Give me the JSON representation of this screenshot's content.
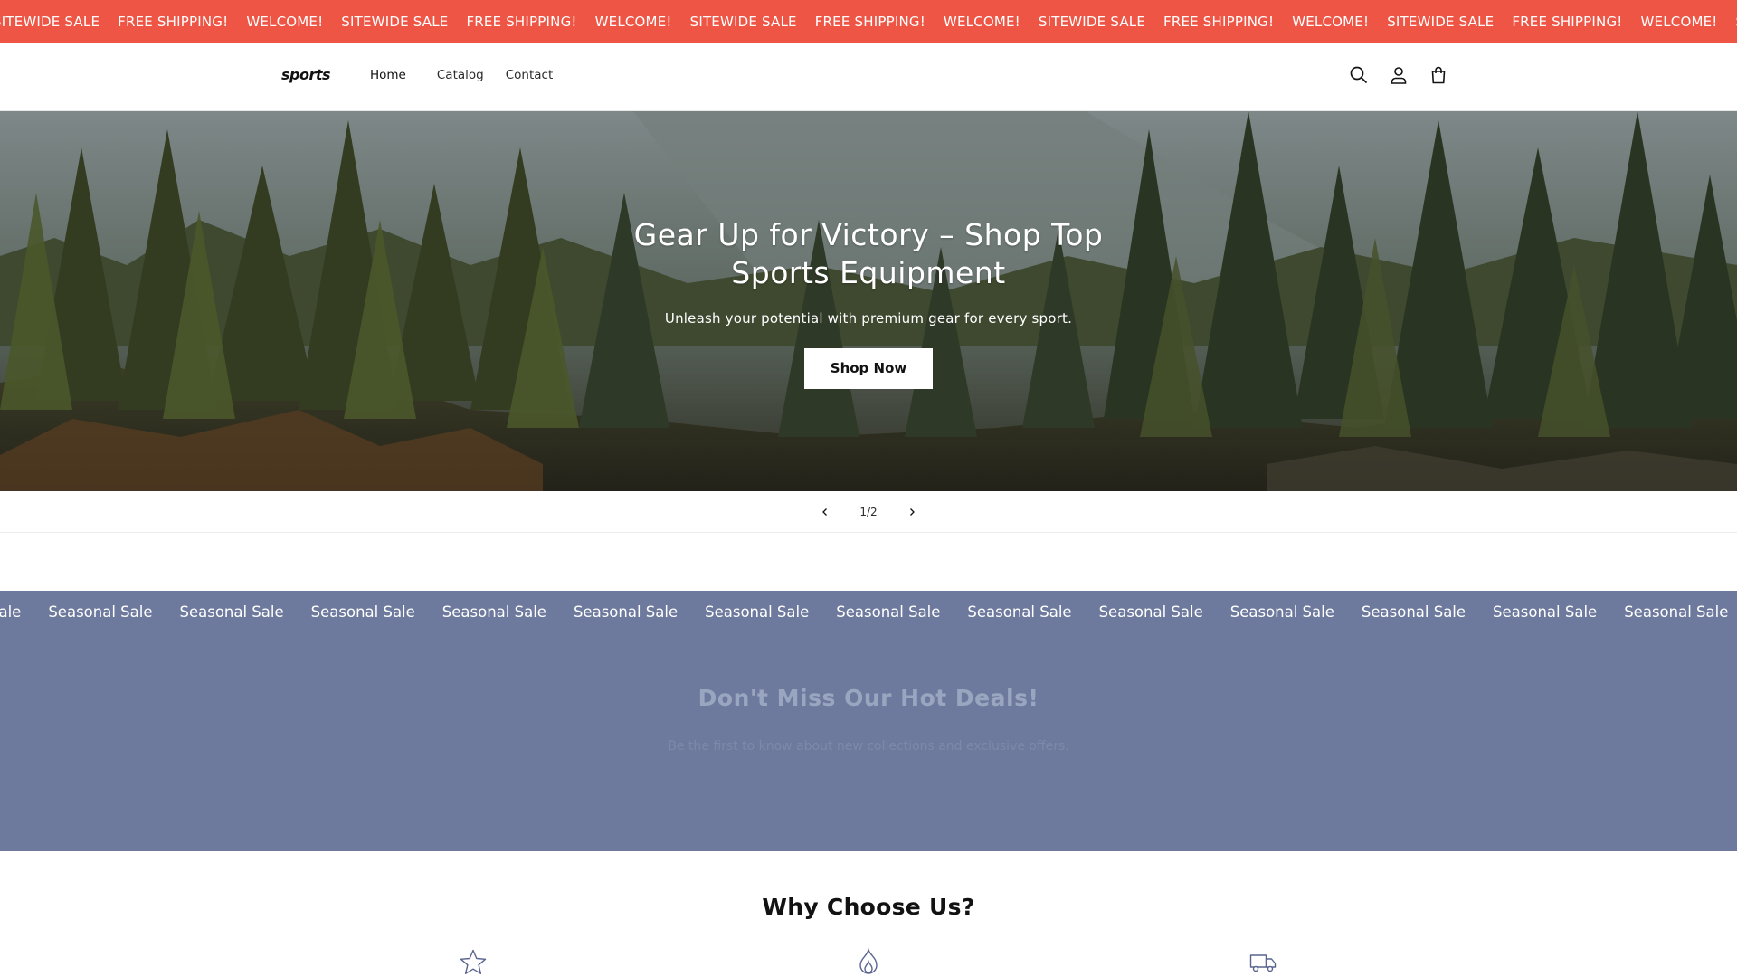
{
  "announcement": {
    "items": [
      "SITEWIDE SALE",
      "FREE SHIPPING!",
      "WELCOME!",
      "SITEWIDE SALE",
      "FREE SHIPPING!",
      "WELCOME!",
      "SITEWIDE SALE",
      "FREE SHIPPING!",
      "WELCOME!",
      "SITEWIDE SALE",
      "FREE SHIPPING!",
      "WELCOME!",
      "SITEWIDE SALE",
      "FREE SHIPPING!",
      "WELCOME!",
      "SITEWIDE SALE"
    ],
    "background": "#ee5545"
  },
  "header": {
    "logo": "sports",
    "nav": {
      "home": "Home",
      "catalog": "Catalog",
      "contact": "Contact"
    },
    "icons": [
      "search-icon",
      "account-icon",
      "cart-icon"
    ]
  },
  "hero": {
    "title": "Gear Up for Victory – Shop Top Sports Equipment",
    "subtitle": "Unleash your potential with premium gear for every sport.",
    "button": "Shop Now"
  },
  "slider": {
    "counter": "1/2",
    "prev_icon": "chevron-left-icon",
    "next_icon": "chevron-right-icon"
  },
  "seasonal": {
    "items": [
      "Sale",
      "Seasonal Sale",
      "Seasonal Sale",
      "Seasonal Sale",
      "Seasonal Sale",
      "Seasonal Sale",
      "Seasonal Sale",
      "Seasonal Sale",
      "Seasonal Sale",
      "Seasonal Sale",
      "Seasonal Sale",
      "Seasonal Sale",
      "Seasonal Sale",
      "Seasonal Sale"
    ],
    "background": "#6d7a9d",
    "title": "Don't Miss Our Hot Deals!",
    "subtitle": "Be the first to know about new collections and exclusive offers."
  },
  "why": {
    "title": "Why Choose Us?",
    "icons": [
      "star-icon",
      "flame-icon",
      "truck-icon"
    ]
  }
}
